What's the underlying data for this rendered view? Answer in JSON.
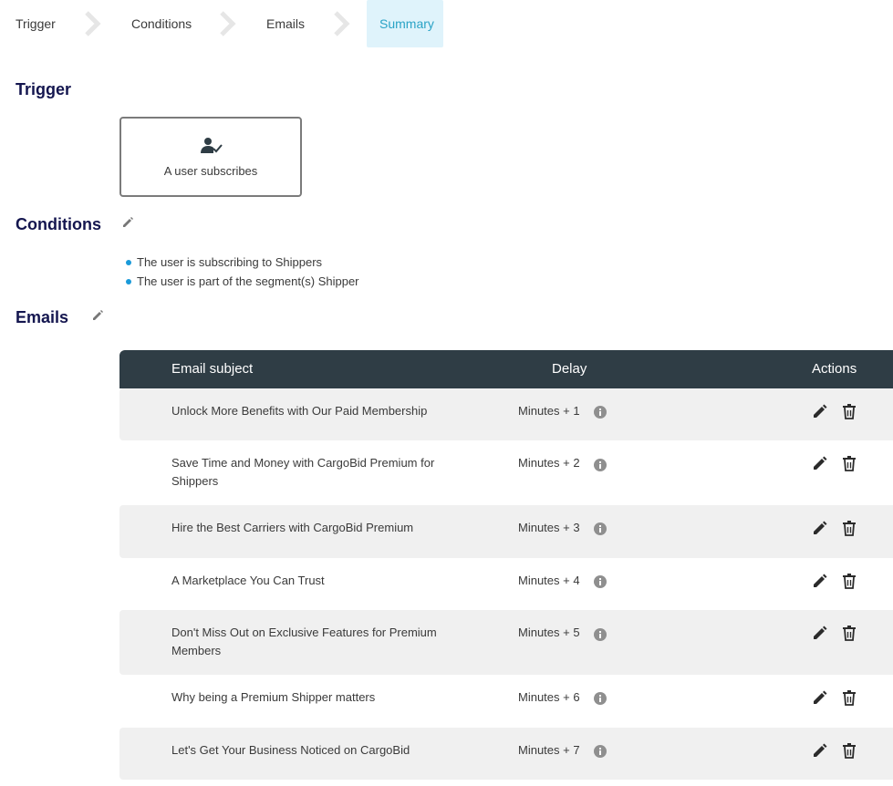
{
  "stepper": {
    "steps": [
      {
        "label": "Trigger"
      },
      {
        "label": "Conditions"
      },
      {
        "label": "Emails"
      },
      {
        "label": "Summary"
      }
    ],
    "active_step": "Summary"
  },
  "trigger": {
    "title": "Trigger",
    "card_label": "A user subscribes",
    "card_icon": "user-check-icon"
  },
  "conditions": {
    "title": "Conditions",
    "items": [
      "The user is subscribing to Shippers",
      "The user is part of the segment(s) Shipper"
    ]
  },
  "emails": {
    "title": "Emails",
    "columns": {
      "subject": "Email subject",
      "delay": "Delay",
      "actions": "Actions"
    },
    "rows": [
      {
        "subject": "Unlock More Benefits with Our Paid Membership",
        "delay": "Minutes + 1"
      },
      {
        "subject": "Save Time and Money with CargoBid Premium for Shippers",
        "delay": "Minutes + 2"
      },
      {
        "subject": "Hire the Best Carriers with CargoBid Premium",
        "delay": "Minutes + 3"
      },
      {
        "subject": "A Marketplace You Can Trust",
        "delay": "Minutes + 4"
      },
      {
        "subject": "Don't Miss Out on Exclusive Features for Premium Members",
        "delay": "Minutes + 5"
      },
      {
        "subject": "Why being a Premium Shipper matters",
        "delay": "Minutes + 6"
      },
      {
        "subject": "Let's Get Your Business Noticed on CargoBid",
        "delay": "Minutes + 7"
      }
    ]
  },
  "colors": {
    "heading": "#14164f",
    "active_step_bg": "#dff3fb",
    "active_step_text": "#2aa3c6",
    "table_header_bg": "#2f3d45",
    "row_shade": "#f0f0f0",
    "bullet": "#1a9ad9"
  }
}
